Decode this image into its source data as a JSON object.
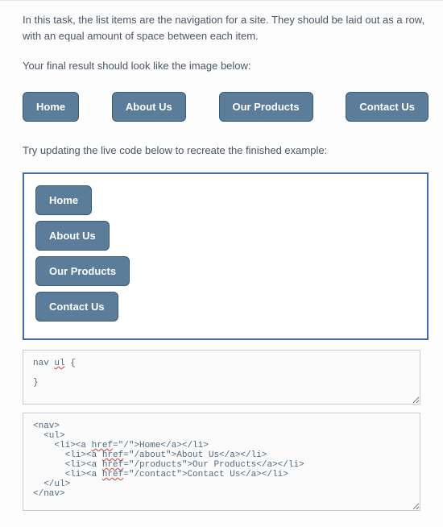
{
  "intro": {
    "p1": "In this task, the list items are the navigation for a site. They should be laid out as a row, with an equal amount of space between each item.",
    "p2": "Your final result should look like the image below:",
    "p3": "Try updating the live code below to recreate the finished example:"
  },
  "nav_items": {
    "home": "Home",
    "about": "About Us",
    "products": "Our Products",
    "contact": "Contact Us"
  },
  "code": {
    "css_open": "nav ",
    "css_sel": "ul",
    "css_brace_open": " {",
    "css_close": "}",
    "html": {
      "nav_open": "<nav>",
      "ul_open": "  <ul>",
      "li_prefix_gap_root": "    <li><a ",
      "li_prefix_gap": "      <li><a ",
      "href_word": "href",
      "eq": "=",
      "home_href": "\"/\">Home</a></li>",
      "about_href": "\"/about\">About Us</a></li>",
      "products_href": "\"/products\">Our Products</a></li>",
      "contact_href": "\"/contact\">Contact Us</a></li>",
      "ul_close": "  </ul>",
      "nav_close": "</nav>"
    }
  }
}
